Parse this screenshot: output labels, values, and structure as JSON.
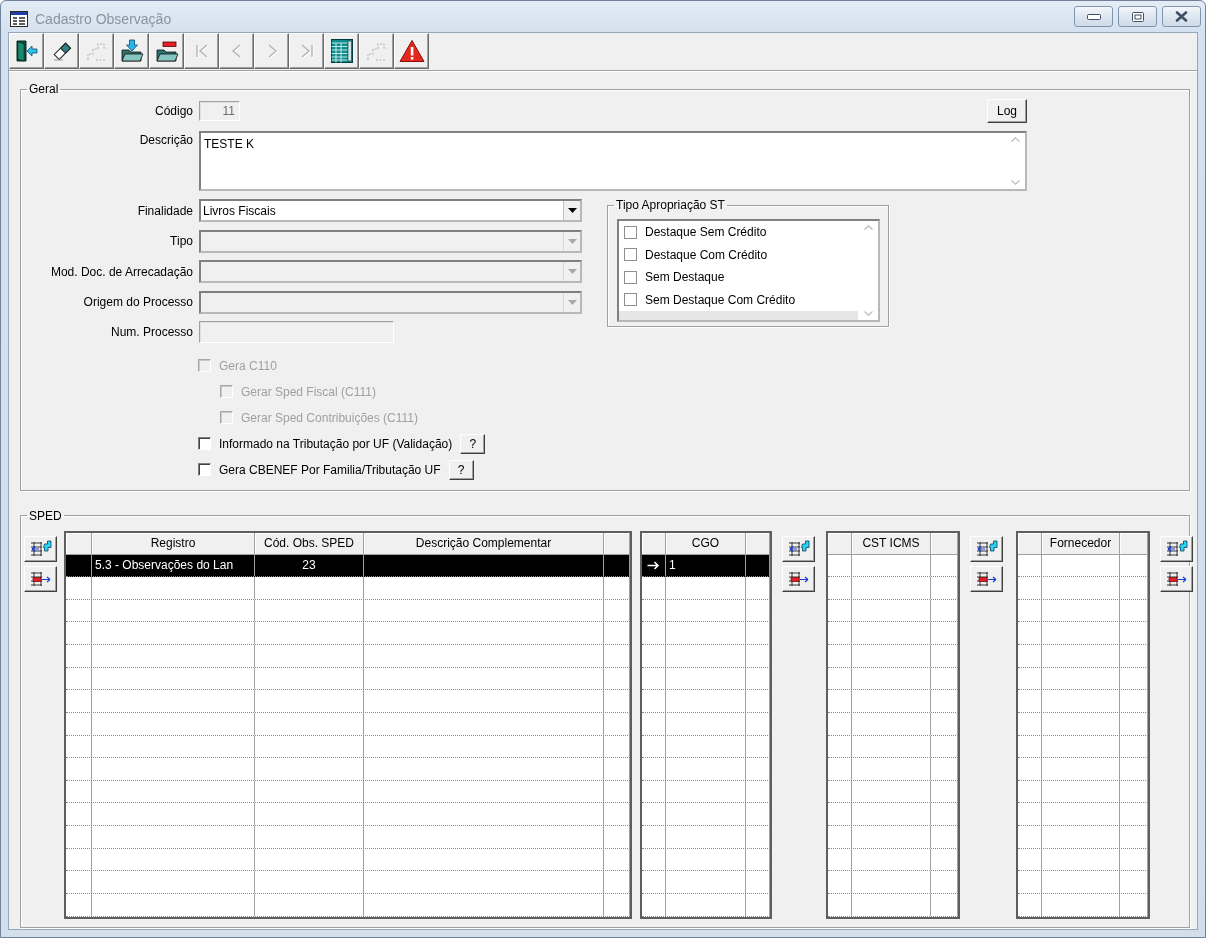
{
  "window": {
    "title": "Cadastro Observação",
    "controls": [
      {
        "kind": "minimize"
      },
      {
        "kind": "restore"
      },
      {
        "kind": "close"
      }
    ]
  },
  "toolbar": [
    {
      "kind": "exit",
      "disabled": false
    },
    {
      "kind": "eraser",
      "disabled": false
    },
    {
      "kind": "steps",
      "disabled": true
    },
    {
      "kind": "folder-in",
      "disabled": false
    },
    {
      "kind": "folder-out",
      "disabled": false
    },
    {
      "kind": "first",
      "disabled": true
    },
    {
      "kind": "prior",
      "disabled": true
    },
    {
      "kind": "next",
      "disabled": true
    },
    {
      "kind": "last",
      "disabled": true
    },
    {
      "kind": "grid",
      "disabled": false
    },
    {
      "kind": "steps",
      "disabled": true
    },
    {
      "kind": "alert",
      "disabled": false
    }
  ],
  "geral": {
    "legend": "Geral",
    "codigo": {
      "label": "Código",
      "value": "11",
      "disabled": true
    },
    "log_button": "Log",
    "descricao": {
      "label": "Descrição",
      "value": "TESTE K"
    },
    "combos": [
      {
        "label": "Finalidade",
        "value": "Livros Fiscais",
        "disabled": false
      },
      {
        "label": "Tipo",
        "disabled": true
      },
      {
        "label": "Mod. Doc. de Arrecadação",
        "disabled": true
      },
      {
        "label": "Origem do Processo",
        "disabled": true
      }
    ],
    "num_processo": {
      "label": "Num. Processo",
      "disabled": true
    },
    "checkboxes": [
      {
        "label": "Gera C110",
        "checked": false,
        "disabled": true,
        "children": [
          {
            "label": "Gerar Sped Fiscal (C111)",
            "checked": false,
            "disabled": true
          },
          {
            "label": "Gerar Sped Contribuições (C111)",
            "checked": false,
            "disabled": true
          }
        ]
      },
      {
        "label": "Informado na Tributação por UF (Validação)",
        "checked": false,
        "disabled": false,
        "help": "?"
      },
      {
        "label": "Gera CBENEF Por Familia/Tributação UF",
        "checked": false,
        "disabled": false,
        "help": "?"
      }
    ],
    "tipo_apropriacao": {
      "legend": "Tipo Apropriação ST",
      "items": [
        {
          "label": "Destaque Sem Crédito",
          "checked": false
        },
        {
          "label": "Destaque Com Crédito",
          "checked": false
        },
        {
          "label": "Sem Destaque",
          "checked": false
        },
        {
          "label": "Sem Destaque Com Crédito",
          "checked": false
        }
      ]
    }
  },
  "sped": {
    "legend": "SPED",
    "grids": [
      {
        "columns": [
          "Registro",
          "Cód. Obs. SPED",
          "Descrição Complementar"
        ],
        "rows": [
          {
            "cells": [
              "5.3 - Observações do Lan",
              "23"
            ],
            "selected": true,
            "current": false
          }
        ]
      },
      {
        "columns": [
          "CGO"
        ],
        "rows": [
          {
            "cells": [
              "1"
            ],
            "selected": true,
            "current": true
          }
        ]
      },
      {
        "columns": [
          "CST ICMS"
        ]
      },
      {
        "columns": [
          "Fornecedor"
        ]
      }
    ]
  }
}
